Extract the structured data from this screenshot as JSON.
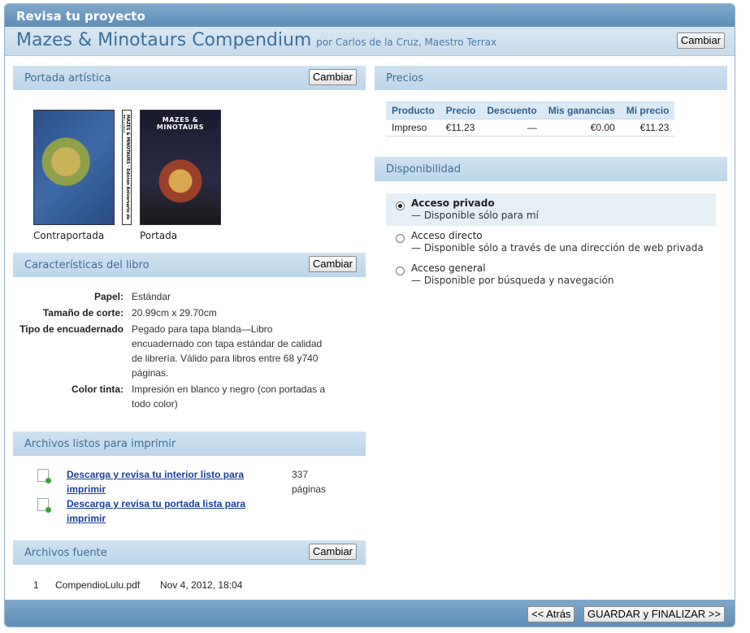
{
  "header": {
    "title": "Revisa tu proyecto",
    "book_title": "Mazes & Minotaurs Compendium",
    "by_line": "por Carlos de la Cruz, Maestro Terrax",
    "change_label": "Cambiar"
  },
  "cover": {
    "section_title": "Portada artística",
    "change_label": "Cambiar",
    "back_caption": "Contraportada",
    "front_caption": "Portada",
    "front_cover_title": "MAZES & MINOTAURS",
    "spine_text": "MAZES & MINOTAURS · Edición Aniversario de Maestro"
  },
  "specs": {
    "section_title": "Características del libro",
    "change_label": "Cambiar",
    "rows": [
      {
        "label": "Papel:",
        "value": "Estándar"
      },
      {
        "label": "Tamaño de corte:",
        "value": "20.99cm x 29.70cm"
      },
      {
        "label": "Tipo de encuadernado",
        "value": "Pegado para tapa blanda—Libro encuadernado con tapa estándar de calidad de librería. Válido para libros entre 68 y740 páginas."
      },
      {
        "label": "Color tinta:",
        "value": "Impresión en blanco y negro (con portadas a todo color)"
      }
    ]
  },
  "print_files": {
    "section_title": "Archivos listos para imprimir",
    "files": [
      {
        "link": "Descarga y revisa tu interior listo para imprimir"
      },
      {
        "link": "Descarga y revisa tu portada lista para imprimir"
      }
    ],
    "pages": "337 páginas"
  },
  "source_files": {
    "section_title": "Archivos fuente",
    "change_label": "Cambiar",
    "rows": [
      {
        "index": "1",
        "name": "CompendioLulu.pdf",
        "date": "Nov 4, 2012, 18:04"
      }
    ]
  },
  "prices": {
    "section_title": "Precios",
    "headers": [
      "Producto",
      "Precio",
      "Descuento",
      "Mis ganancias",
      "Mi precio"
    ],
    "rows": [
      [
        "Impreso",
        "€11.23",
        "—",
        "€0.00",
        "€11.23"
      ]
    ]
  },
  "availability": {
    "section_title": "Disponibilidad",
    "options": [
      {
        "title": "Acceso privado",
        "desc": "— Disponible sólo para mí",
        "selected": true
      },
      {
        "title": "Acceso directo",
        "desc": "— Disponible sólo a través de una dirección de web privada",
        "selected": false
      },
      {
        "title": "Acceso general",
        "desc": "— Disponible por búsqueda y navegación",
        "selected": false
      }
    ]
  },
  "footer": {
    "back_label": "<< Atrás",
    "save_label": "GUARDAR y FINALIZAR >>"
  },
  "colors": {
    "bar_blue": "#6f9bc1",
    "section_blue": "#c7dcee",
    "link_blue": "#1a3f9a"
  }
}
